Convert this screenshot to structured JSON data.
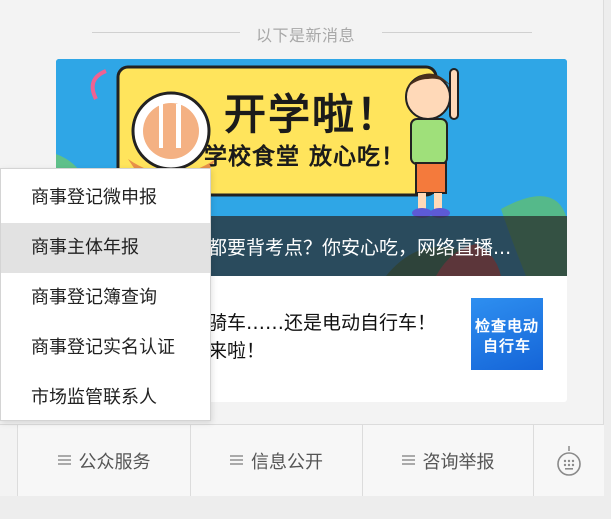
{
  "divider": {
    "text": "以下是新消息"
  },
  "article": {
    "banner": {
      "headline": "开学啦！",
      "subline": "学校食堂 放心吃！",
      "caption": "都要背考点？你安心吃，网络直播..."
    },
    "item2": {
      "title_line1": "骑车……还是电动自行车！",
      "title_line2": "来啦！",
      "thumb_line1": "检查电动",
      "thumb_line2": "自行车"
    }
  },
  "popup_menu": {
    "items": [
      {
        "label": "商事登记微申报"
      },
      {
        "label": "商事主体年报"
      },
      {
        "label": "商事登记簿查询"
      },
      {
        "label": "商事登记实名认证"
      },
      {
        "label": "市场监管联系人"
      }
    ],
    "active_index": 1
  },
  "bottom_bar": {
    "buttons": [
      {
        "label": "公众服务",
        "icon": "menu-lines-icon"
      },
      {
        "label": "信息公开",
        "icon": "menu-lines-icon"
      },
      {
        "label": "咨询举报",
        "icon": "menu-lines-icon"
      }
    ],
    "keyboard_icon": "keyboard-icon"
  },
  "colors": {
    "banner_blue": "#2fa6e6",
    "banner_yellow": "#ffe45c",
    "menu_active": "#e2e2e2",
    "thumb_blue": "#1f74e0"
  }
}
